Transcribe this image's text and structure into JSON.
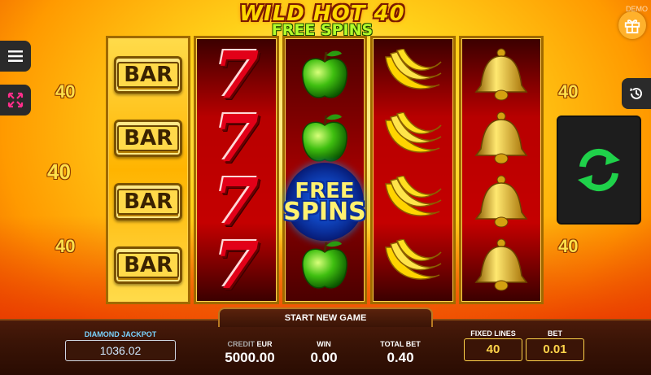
{
  "logo": {
    "title": "WILD HOT 40",
    "subtitle": "FREE SPINS"
  },
  "demo_label": "DEMO",
  "icons": {
    "menu": "menu-icon",
    "fullscreen": "fullscreen-icon",
    "history": "history-icon",
    "gift": "gift-icon",
    "spin": "refresh-spin-icon"
  },
  "line_numbers": {
    "left": [
      "40",
      "40",
      "40"
    ],
    "right": [
      "40",
      "40"
    ]
  },
  "reels": [
    {
      "symbols": [
        "BAR",
        "BAR",
        "BAR",
        "BAR"
      ]
    },
    {
      "symbols": [
        "7",
        "7",
        "7",
        "7"
      ]
    },
    {
      "symbols": [
        "apple",
        "apple",
        "FREE SPINS",
        "apple"
      ]
    },
    {
      "symbols": [
        "banana",
        "banana",
        "banana",
        "banana"
      ]
    },
    {
      "symbols": [
        "bell",
        "bell",
        "bell",
        "bell"
      ]
    }
  ],
  "free_spins_symbol": {
    "line1": "FREE",
    "line2": "SPINS"
  },
  "bottom": {
    "start_new_game": "START NEW GAME",
    "diamond_jackpot_label": "DIAMOND JACKPOT",
    "diamond_jackpot_value": "1036.02",
    "credit_label": "CREDIT",
    "currency": "EUR",
    "credit_value": "5000.00",
    "win_label": "WIN",
    "win_value": "0.00",
    "total_bet_label": "TOTAL BET",
    "total_bet_value": "0.40",
    "fixed_lines_label": "FIXED LINES",
    "fixed_lines_value": "40",
    "bet_label": "BET",
    "bet_value": "0.01"
  },
  "colors": {
    "accent_gold": "#ffd44a",
    "reel_red": "#c40000",
    "spin_green": "#1fd14a",
    "jackpot_blue": "#7ad3ff"
  }
}
